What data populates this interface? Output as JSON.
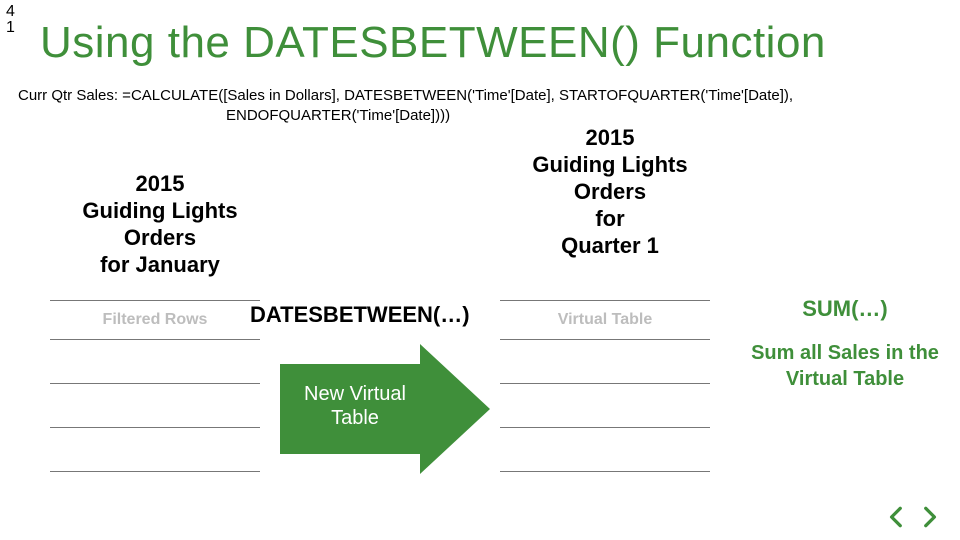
{
  "page_number_top": "4",
  "page_number_bottom": "1",
  "title": "Using the DATESBETWEEN() Function",
  "formula": {
    "line1": "Curr Qtr Sales: =CALCULATE([Sales in Dollars], DATESBETWEEN('Time'[Date], STARTOFQUARTER('Time'[Date]),",
    "line2": "ENDOFQUARTER('Time'[Date])))"
  },
  "captions": {
    "left": "2015\nGuiding Lights\nOrders\nfor January",
    "right": "2015\nGuiding Lights\nOrders\nfor\nQuarter 1"
  },
  "tables": {
    "left_header": "Filtered Rows",
    "right_header": "Virtual Table"
  },
  "center": {
    "func": "DATESBETWEEN(…)",
    "arrow_label": "New Virtual Table"
  },
  "sum": {
    "title": "SUM(…)",
    "text": "Sum all Sales in the Virtual Table"
  },
  "colors": {
    "accent_green": "#3f8f3a",
    "arrow_fill": "#3f8f3a",
    "grey_text": "#bdbdbd"
  }
}
